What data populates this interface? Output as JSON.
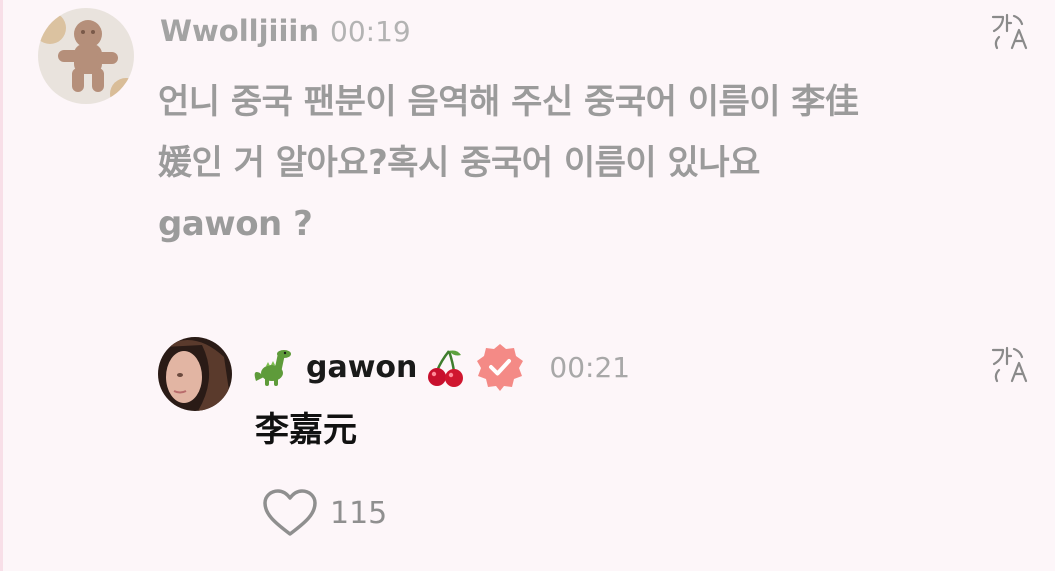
{
  "comment": {
    "author": "Wwolljiiin",
    "time": "00:19",
    "lines": [
      "언니 중국 팬분이 음역해 주신 중국어 이름이 李佳",
      "媛인 거 알아요?혹시 중국어 이름이 있나요",
      "gawon ?"
    ],
    "translate_icon": "translate-icon"
  },
  "reply": {
    "author": "gawon",
    "author_emoji_left": "dinosaur",
    "author_emoji_right": "cherries",
    "verified": true,
    "time": "00:21",
    "text": "李嘉元",
    "likes": "115",
    "translate_icon": "translate-icon"
  },
  "colors": {
    "background": "#fdf6f9",
    "verified_badge": "#f48a86",
    "muted_text": "#9b9b9b"
  }
}
